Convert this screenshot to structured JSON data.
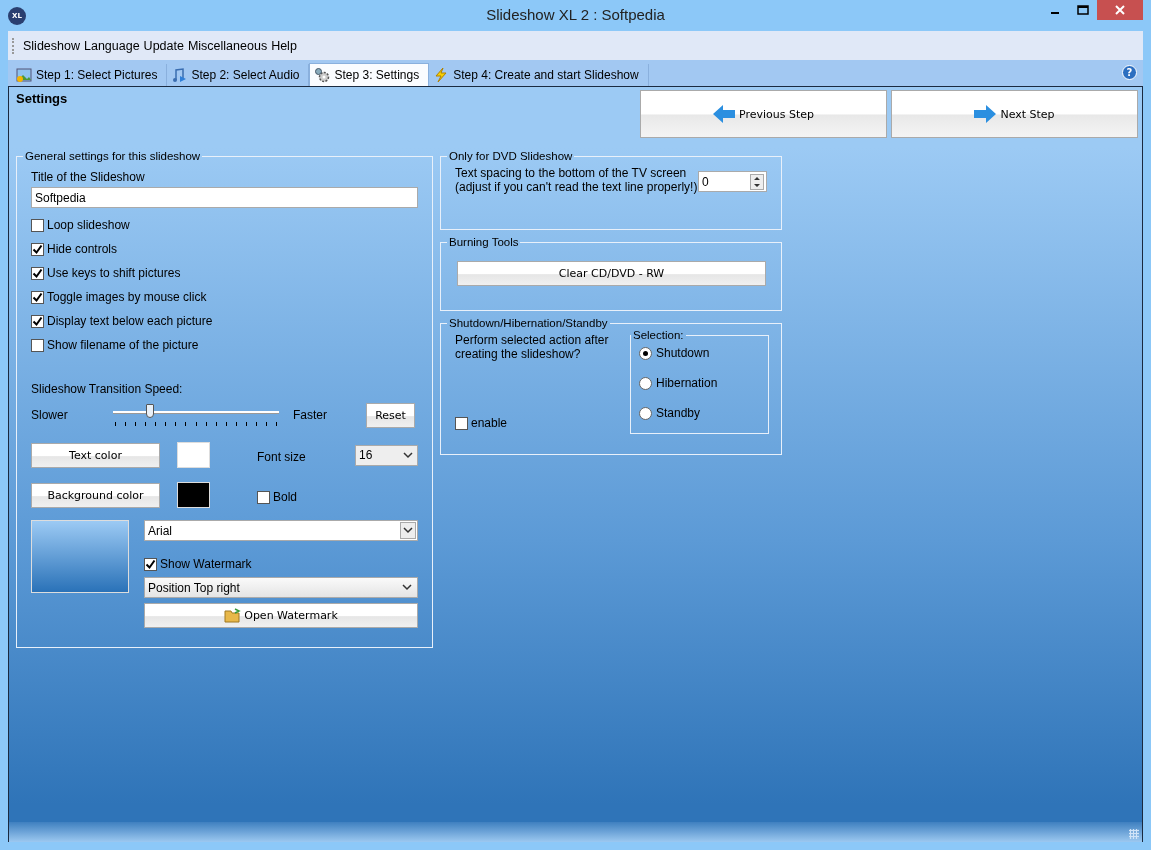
{
  "window": {
    "title": "Slideshow XL 2 : Softpedia",
    "app_badge": "XL"
  },
  "menu": [
    "Slideshow",
    "Language",
    "Update",
    "Miscellaneous",
    "Help"
  ],
  "tabs": [
    {
      "label": "Step 1: Select Pictures",
      "selected": false,
      "kind": "pictures"
    },
    {
      "label": "Step 2: Select Audio",
      "selected": false,
      "kind": "audio"
    },
    {
      "label": "Step 3: Settings",
      "selected": true,
      "kind": "settings"
    },
    {
      "label": "Step 4: Create and start Slideshow",
      "selected": false,
      "kind": "create"
    }
  ],
  "help": "?",
  "page_title": "Settings",
  "nav": {
    "previous": "Previous Step",
    "next": "Next Step"
  },
  "general": {
    "legend": "General settings for this slideshow",
    "title_label": "Title of the Slideshow",
    "title_value": "Softpedia",
    "options": [
      {
        "label": "Loop slideshow",
        "checked": false
      },
      {
        "label": "Hide controls",
        "checked": true
      },
      {
        "label": "Use keys to shift pictures",
        "checked": true
      },
      {
        "label": "Toggle images by mouse click",
        "checked": true
      },
      {
        "label": "Display text below each picture",
        "checked": true
      },
      {
        "label": "Show filename of the picture",
        "checked": false
      }
    ],
    "speed": {
      "label": "Slideshow Transition Speed:",
      "slower": "Slower",
      "faster": "Faster",
      "level": 0.22,
      "reset": "Reset"
    },
    "text_color": {
      "label": "Text color",
      "color": "#ffffff"
    },
    "background_color": {
      "label": "Background color",
      "color": "#000000"
    },
    "font_size": {
      "label": "Font size",
      "value": "16"
    },
    "bold": {
      "label": "Bold",
      "checked": false
    },
    "font": "Arial",
    "watermark": {
      "label": "Show Watermark",
      "checked": true,
      "position": "Position Top right",
      "open": "Open Watermark"
    }
  },
  "dvd": {
    "legend": "Only for DVD Slideshow",
    "text": "Text spacing to the bottom of the TV screen",
    "text2": "(adjust if you can't read the text line properly!)",
    "value": "0"
  },
  "burning": {
    "legend": "Burning Tools",
    "button": "Clear CD/DVD - RW"
  },
  "shutdown": {
    "legend": "Shutdown/Hibernation/Standby",
    "question": "Perform selected action after creating the slideshow?",
    "enable": {
      "label": "enable",
      "checked": false
    },
    "selection_legend": "Selection:",
    "options": [
      {
        "label": "Shutdown",
        "selected": true
      },
      {
        "label": "Hibernation",
        "selected": false
      },
      {
        "label": "Standby",
        "selected": false
      }
    ]
  }
}
